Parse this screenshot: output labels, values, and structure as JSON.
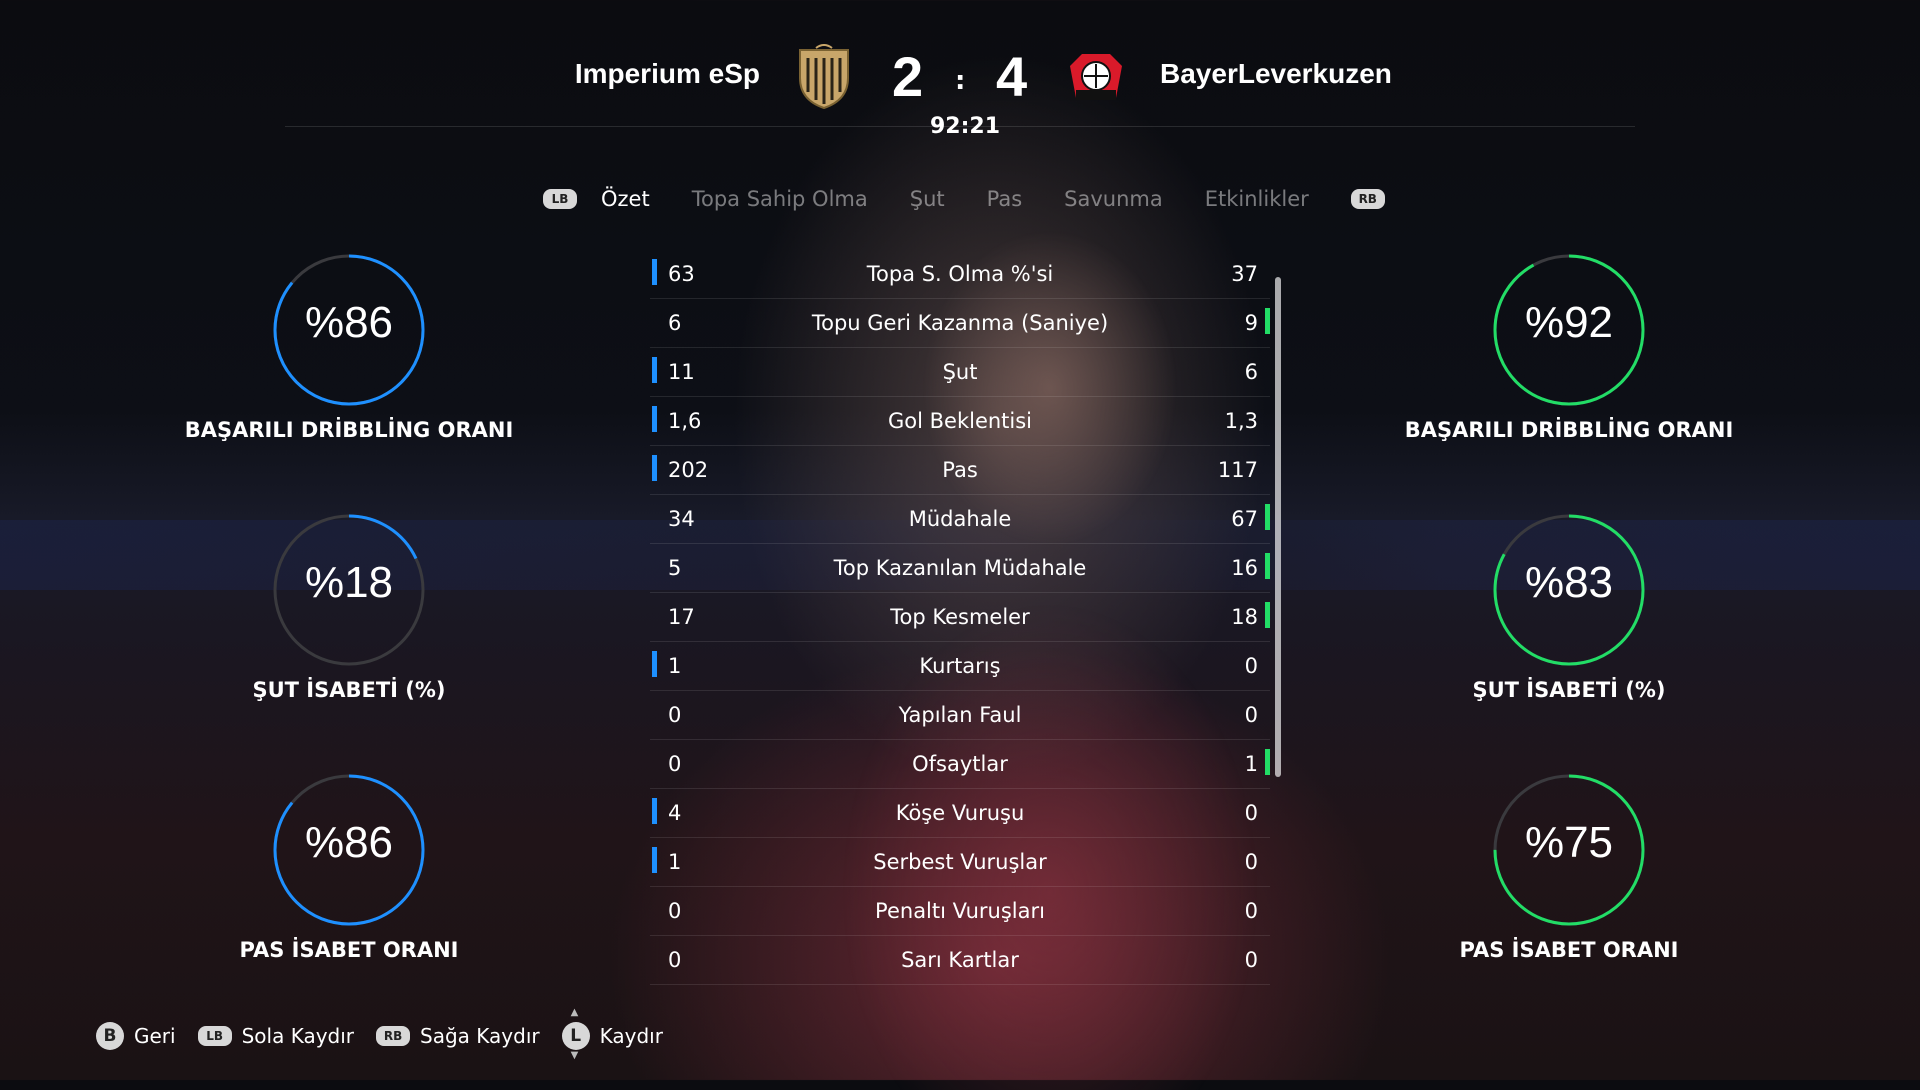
{
  "header": {
    "home_team": "Imperium eSp",
    "away_team": "BayerLeverkuzen",
    "home_score": "2",
    "away_score": "4",
    "separator": ":",
    "clock": "92:21"
  },
  "tabs": {
    "lb": "LB",
    "rb": "RB",
    "items": [
      "Özet",
      "Topa Sahip Olma",
      "Şut",
      "Pas",
      "Savunma",
      "Etkinlikler"
    ],
    "active_index": 0
  },
  "stats": [
    {
      "home": "63",
      "label": "Topa S. Olma %'si",
      "away": "37",
      "leader": "home"
    },
    {
      "home": "6",
      "label": "Topu Geri Kazanma (Saniye)",
      "away": "9",
      "leader": "away"
    },
    {
      "home": "11",
      "label": "Şut",
      "away": "6",
      "leader": "home"
    },
    {
      "home": "1,6",
      "label": "Gol Beklentisi",
      "away": "1,3",
      "leader": "home"
    },
    {
      "home": "202",
      "label": "Pas",
      "away": "117",
      "leader": "home"
    },
    {
      "home": "34",
      "label": "Müdahale",
      "away": "67",
      "leader": "away"
    },
    {
      "home": "5",
      "label": "Top Kazanılan Müdahale",
      "away": "16",
      "leader": "away"
    },
    {
      "home": "17",
      "label": "Top Kesmeler",
      "away": "18",
      "leader": "away"
    },
    {
      "home": "1",
      "label": "Kurtarış",
      "away": "0",
      "leader": "home"
    },
    {
      "home": "0",
      "label": "Yapılan Faul",
      "away": "0",
      "leader": "none"
    },
    {
      "home": "0",
      "label": "Ofsaytlar",
      "away": "1",
      "leader": "away"
    },
    {
      "home": "4",
      "label": "Köşe Vuruşu",
      "away": "0",
      "leader": "home"
    },
    {
      "home": "1",
      "label": "Serbest Vuruşlar",
      "away": "0",
      "leader": "home"
    },
    {
      "home": "0",
      "label": "Penaltı Vuruşları",
      "away": "0",
      "leader": "none"
    },
    {
      "home": "0",
      "label": "Sarı Kartlar",
      "away": "0",
      "leader": "none"
    }
  ],
  "home_gauges": [
    {
      "value": "%86",
      "percent": 86,
      "label": "BAŞARILI DRİBBLİNG ORANI"
    },
    {
      "value": "%18",
      "percent": 18,
      "label": "ŞUT İSABETİ (%)"
    },
    {
      "value": "%86",
      "percent": 86,
      "label": "PAS İSABET ORANI"
    }
  ],
  "away_gauges": [
    {
      "value": "%92",
      "percent": 92,
      "label": "BAŞARILI DRİBBLİNG ORANI"
    },
    {
      "value": "%83",
      "percent": 83,
      "label": "ŞUT İSABETİ (%)"
    },
    {
      "value": "%75",
      "percent": 75,
      "label": "PAS İSABET ORANI"
    }
  ],
  "footer": {
    "back_key": "B",
    "back_label": "Geri",
    "left_key": "LB",
    "left_label": "Sola Kaydır",
    "right_key": "RB",
    "right_label": "Sağa Kaydır",
    "scroll_key": "L",
    "scroll_label": "Kaydır"
  },
  "colors": {
    "home_accent": "#1e90ff",
    "away_accent": "#22dd66"
  }
}
